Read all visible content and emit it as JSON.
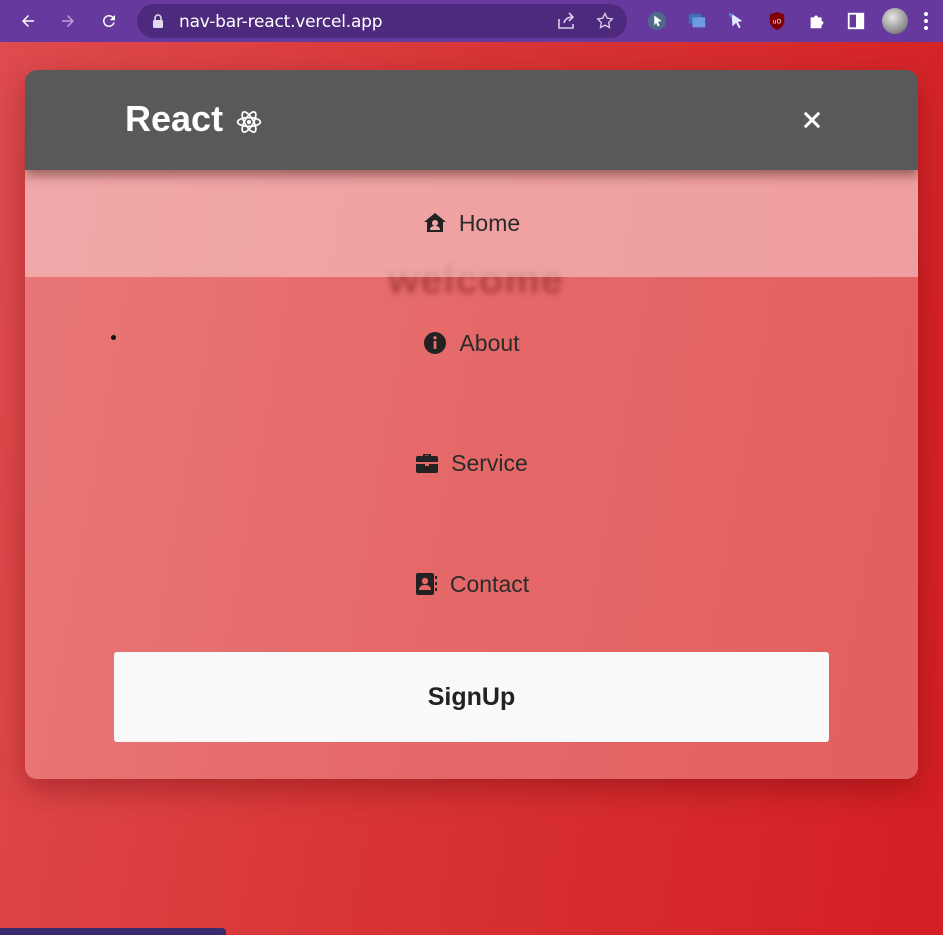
{
  "browser": {
    "url": "nav-bar-react.vercel.app",
    "chrome_color": "#66399e"
  },
  "navbar": {
    "brand": "React",
    "brand_icon": "react-atom-icon",
    "close_icon": "close-icon",
    "header_color": "#595959"
  },
  "menu": {
    "items": [
      {
        "label": "Home",
        "icon": "home-user-icon"
      },
      {
        "label": "About",
        "icon": "info-circle-icon"
      },
      {
        "label": "Service",
        "icon": "briefcase-icon"
      },
      {
        "label": "Contact",
        "icon": "address-book-icon"
      }
    ],
    "signup_label": "SignUp"
  },
  "page": {
    "background_text": "welcome",
    "accent_color": "#d42c2c"
  }
}
